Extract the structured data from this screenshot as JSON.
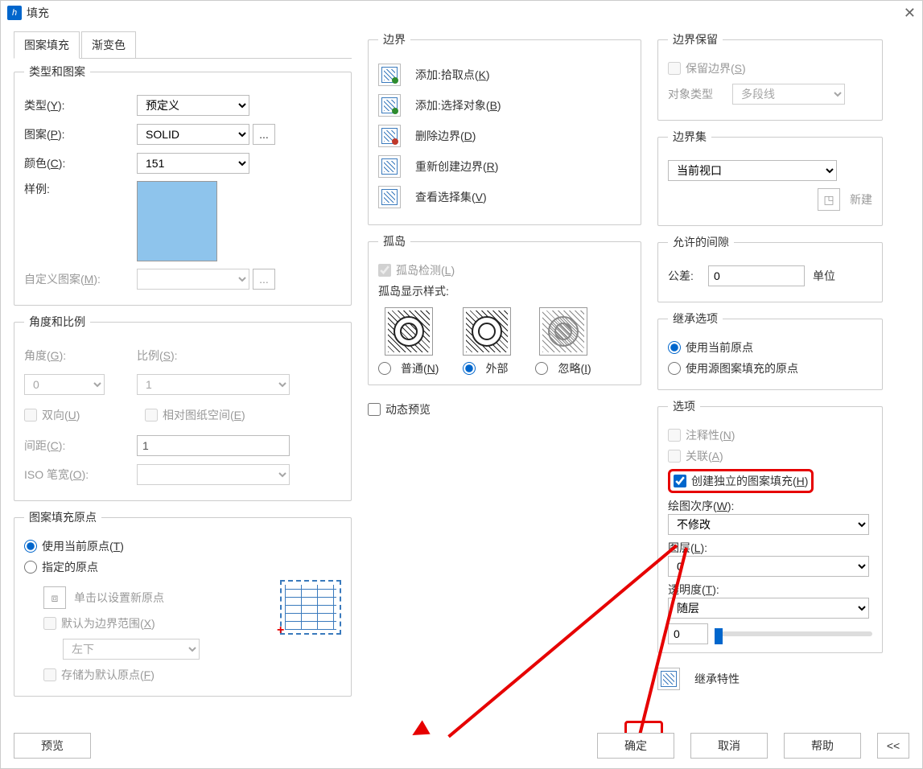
{
  "window": {
    "title": "填充"
  },
  "tabs": {
    "pattern": "图案填充",
    "gradient": "渐变色"
  },
  "typeGroup": {
    "legend": "类型和图案",
    "typeLabel": "类型(Y):",
    "typeValue": "预定义",
    "patternLabel": "图案(P):",
    "patternValue": "SOLID",
    "colorLabel": "颜色(C):",
    "colorValue": "151",
    "sampleLabel": "样例:",
    "customLabel": "自定义图案(M):"
  },
  "angleGroup": {
    "legend": "角度和比例",
    "angleLabel": "角度(G):",
    "angleValue": "0",
    "scaleLabel": "比例(S):",
    "scaleValue": "1",
    "bidir": "双向(U)",
    "relPaper": "相对图纸空间(E)",
    "spacingLabel": "间距(C):",
    "spacingValue": "1",
    "isoLabel": "ISO 笔宽(O):"
  },
  "originGroup": {
    "legend": "图案填充原点",
    "useCurrent": "使用当前原点(T)",
    "specified": "指定的原点",
    "clickSet": "单击以设置新原点",
    "defaultBoundary": "默认为边界范围(X)",
    "posValue": "左下",
    "storeDefault": "存储为默认原点(F)"
  },
  "boundaryGroup": {
    "legend": "边界",
    "pick": "添加:拾取点(K)",
    "select": "添加:选择对象(B)",
    "remove": "删除边界(D)",
    "recreate": "重新创建边界(R)",
    "view": "查看选择集(V)"
  },
  "islandGroup": {
    "legend": "孤岛",
    "detect": "孤岛检测(L)",
    "styleLabel": "孤岛显示样式:",
    "normal": "普通(N)",
    "outer": "外部",
    "ignore": "忽略(I)"
  },
  "dynPreview": "动态预览",
  "retainGroup": {
    "legend": "边界保留",
    "retain": "保留边界(S)",
    "objTypeLabel": "对象类型",
    "objTypeValue": "多段线"
  },
  "setGroup": {
    "legend": "边界集",
    "value": "当前视口",
    "newBtn": "新建"
  },
  "gapGroup": {
    "legend": "允许的间隙",
    "tolLabel": "公差:",
    "tolValue": "0",
    "unit": "单位"
  },
  "inheritGroup": {
    "legend": "继承选项",
    "useCurrent": "使用当前原点",
    "useSource": "使用源图案填充的原点"
  },
  "optGroup": {
    "legend": "选项",
    "annotative": "注释性(N)",
    "assoc": "关联(A)",
    "separate": "创建独立的图案填充(H)",
    "drawOrderLabel": "绘图次序(W):",
    "drawOrderValue": "不修改",
    "layerLabel": "图层(L):",
    "layerValue": "0",
    "transLabel": "透明度(T):",
    "transValue": "随层",
    "transNum": "0"
  },
  "inheritProps": "继承特性",
  "footer": {
    "preview": "预览",
    "ok": "确定",
    "cancel": "取消",
    "help": "帮助",
    "collapse": "<<"
  }
}
